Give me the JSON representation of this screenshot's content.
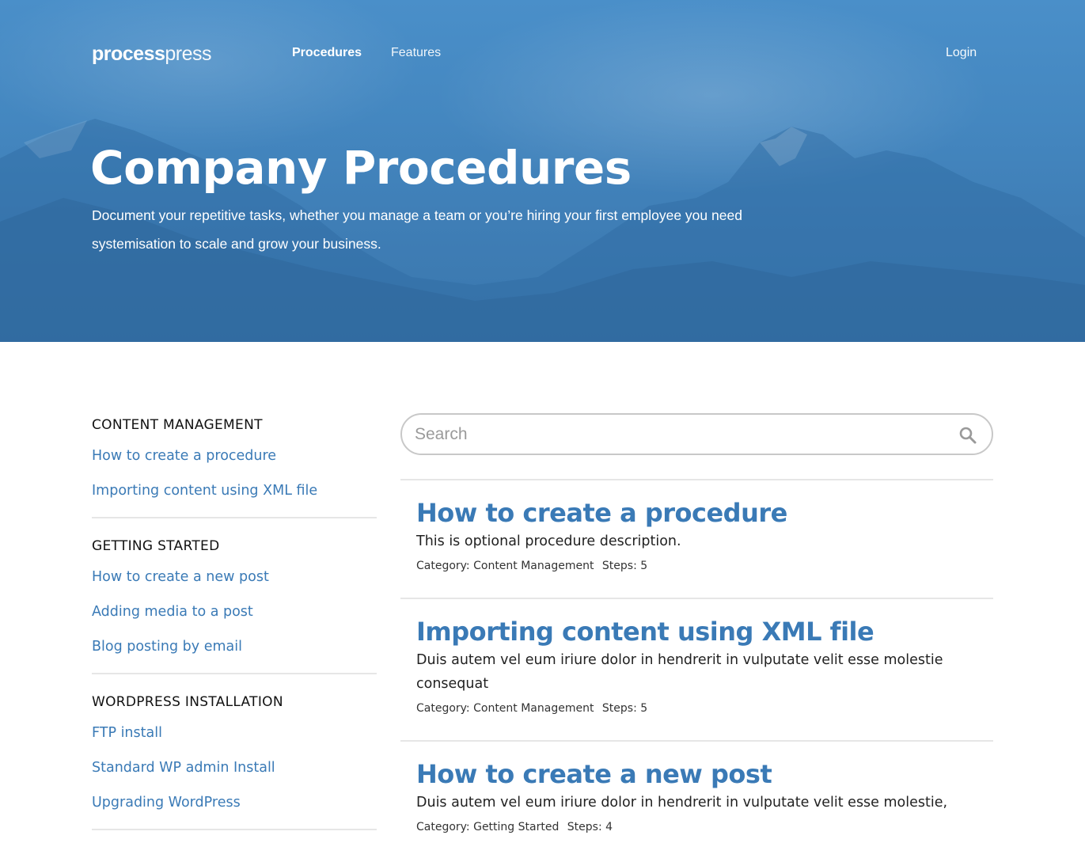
{
  "brand": {
    "bold": "process",
    "light": "press"
  },
  "nav": {
    "procedures": "Procedures",
    "features": "Features",
    "login": "Login"
  },
  "hero": {
    "title": "Company Procedures",
    "subtitle": "Document your repetitive tasks, whether you manage a team or you’re hiring your first employee you need systemisation to scale and grow your business."
  },
  "sidebar": {
    "categories": [
      {
        "title": "CONTENT MANAGEMENT",
        "items": [
          "How to create a procedure",
          "Importing content using XML file"
        ]
      },
      {
        "title": "GETTING STARTED",
        "items": [
          "How to create a new post",
          "Adding media to a post",
          "Blog posting by email"
        ]
      },
      {
        "title": "WORDPRESS INSTALLATION",
        "items": [
          "FTP install",
          "Standard WP admin Install",
          "Upgrading WordPress"
        ]
      }
    ]
  },
  "search": {
    "placeholder": "Search",
    "value": ""
  },
  "results": [
    {
      "title": "How to create a procedure",
      "description": "This is optional procedure description.",
      "category": "Category: Content Management",
      "steps": "Steps: 5"
    },
    {
      "title": "Importing content using XML file",
      "description": "Duis autem vel eum iriure dolor in hendrerit in vulputate velit esse molestie consequat",
      "category": "Category: Content Management",
      "steps": "Steps: 5"
    },
    {
      "title": "How to create a new post",
      "description": "Duis autem vel eum iriure dolor in hendrerit in vulputate velit esse molestie,",
      "category": "Category: Getting Started",
      "steps": "Steps: 4"
    }
  ],
  "colors": {
    "accent": "#3a7ab6",
    "hero": "#4487c0",
    "divider": "#e6e6e6"
  },
  "icons": {
    "search": "search-icon"
  }
}
